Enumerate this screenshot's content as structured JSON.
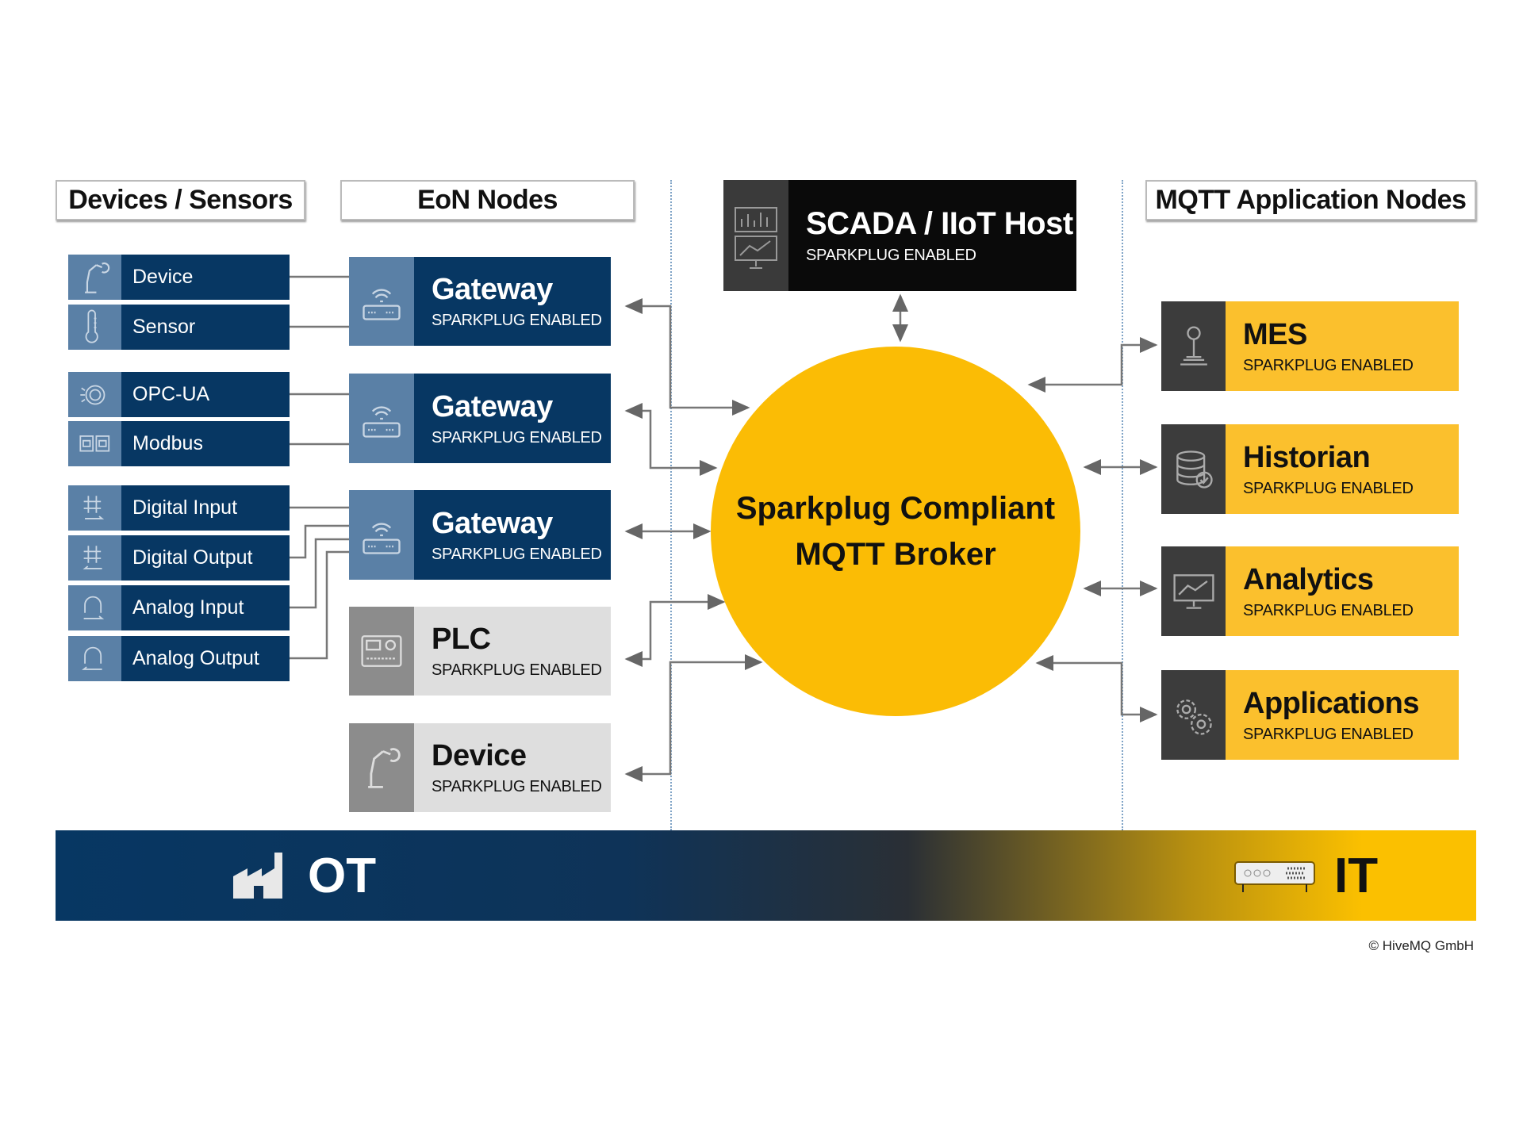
{
  "headers": {
    "devices": "Devices / Sensors",
    "eon": "EoN Nodes",
    "apps": "MQTT Application Nodes"
  },
  "devices": [
    {
      "label": "Device",
      "icon": "robot-arm-icon"
    },
    {
      "label": "Sensor",
      "icon": "thermometer-icon"
    },
    {
      "label": "OPC-UA",
      "icon": "opc-ua-icon"
    },
    {
      "label": "Modbus",
      "icon": "modbus-ports-icon"
    },
    {
      "label": "Digital Input",
      "icon": "digital-input-icon"
    },
    {
      "label": "Digital Output",
      "icon": "digital-output-icon"
    },
    {
      "label": "Analog Input",
      "icon": "analog-input-icon"
    },
    {
      "label": "Analog Output",
      "icon": "analog-output-icon"
    }
  ],
  "eon_nodes": [
    {
      "title": "Gateway",
      "subtitle": "SPARKPLUG ENABLED",
      "icon": "router-icon",
      "style": "blue"
    },
    {
      "title": "Gateway",
      "subtitle": "SPARKPLUG ENABLED",
      "icon": "router-icon",
      "style": "blue"
    },
    {
      "title": "Gateway",
      "subtitle": "SPARKPLUG ENABLED",
      "icon": "router-icon",
      "style": "blue"
    },
    {
      "title": "PLC",
      "subtitle": "SPARKPLUG ENABLED",
      "icon": "plc-icon",
      "style": "gray"
    },
    {
      "title": "Device",
      "subtitle": "SPARKPLUG ENABLED",
      "icon": "robot-arm-icon",
      "style": "gray"
    }
  ],
  "scada": {
    "title": "SCADA / IIoT Host",
    "subtitle": "SPARKPLUG ENABLED",
    "icon": "monitor-chart-icon"
  },
  "broker": {
    "line1": "Sparkplug Compliant",
    "line2": "MQTT Broker"
  },
  "app_nodes": [
    {
      "title": "MES",
      "subtitle": "SPARKPLUG ENABLED",
      "icon": "joystick-icon"
    },
    {
      "title": "Historian",
      "subtitle": "SPARKPLUG ENABLED",
      "icon": "database-icon"
    },
    {
      "title": "Analytics",
      "subtitle": "SPARKPLUG ENABLED",
      "icon": "monitor-chart-icon"
    },
    {
      "title": "Applications",
      "subtitle": "SPARKPLUG ENABLED",
      "icon": "gears-icon"
    }
  ],
  "bar": {
    "left": "OT",
    "right": "IT",
    "left_icon": "factory-icon",
    "right_icon": "server-icon"
  },
  "copyright": "© HiveMQ GmbH",
  "colors": {
    "navy": "#073763",
    "steel": "#5a80a6",
    "yellow": "#fbc02d",
    "broker": "#fbbc05",
    "dark": "#0a0a0a"
  }
}
